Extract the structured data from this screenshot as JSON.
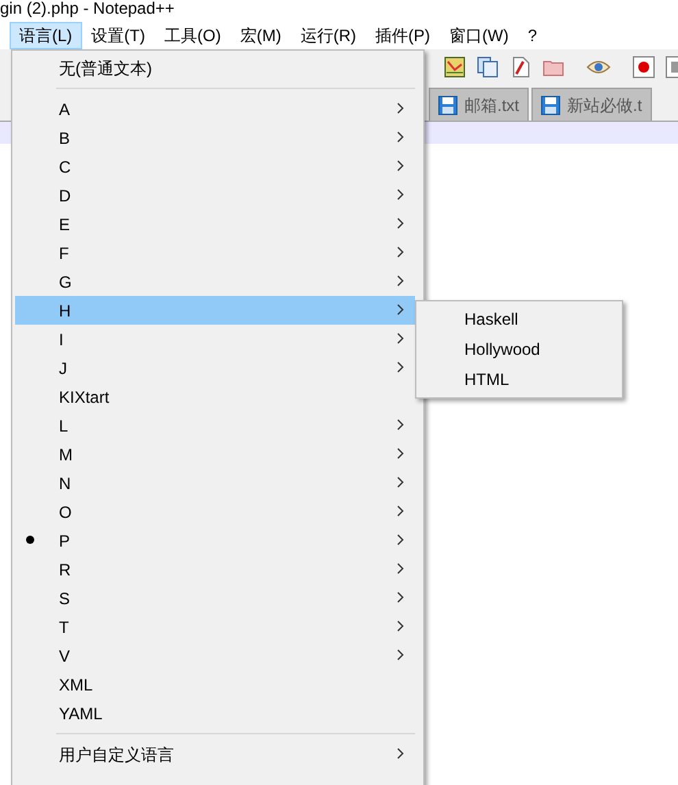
{
  "window": {
    "title": "gin (2).php - Notepad++"
  },
  "menu_bar": [
    {
      "label": "语言(L)",
      "selected": true
    },
    {
      "label": "设置(T)",
      "selected": false
    },
    {
      "label": "工具(O)",
      "selected": false
    },
    {
      "label": "宏(M)",
      "selected": false
    },
    {
      "label": "运行(R)",
      "selected": false
    },
    {
      "label": "插件(P)",
      "selected": false
    },
    {
      "label": "窗口(W)",
      "selected": false
    },
    {
      "label": "?",
      "selected": false
    }
  ],
  "tabs": [
    {
      "label": "邮箱.txt",
      "selected": false
    },
    {
      "label": "新站必做.t",
      "selected": false
    }
  ],
  "language_menu": [
    {
      "kind": "item",
      "label": "无(普通文本)",
      "submenu": false,
      "checked": false,
      "selected": false
    },
    {
      "kind": "separator"
    },
    {
      "kind": "item",
      "label": "A",
      "submenu": true,
      "checked": false,
      "selected": false
    },
    {
      "kind": "item",
      "label": "B",
      "submenu": true,
      "checked": false,
      "selected": false
    },
    {
      "kind": "item",
      "label": "C",
      "submenu": true,
      "checked": false,
      "selected": false
    },
    {
      "kind": "item",
      "label": "D",
      "submenu": true,
      "checked": false,
      "selected": false
    },
    {
      "kind": "item",
      "label": "E",
      "submenu": true,
      "checked": false,
      "selected": false
    },
    {
      "kind": "item",
      "label": "F",
      "submenu": true,
      "checked": false,
      "selected": false
    },
    {
      "kind": "item",
      "label": "G",
      "submenu": true,
      "checked": false,
      "selected": false
    },
    {
      "kind": "item",
      "label": "H",
      "submenu": true,
      "checked": false,
      "selected": true
    },
    {
      "kind": "item",
      "label": "I",
      "submenu": true,
      "checked": false,
      "selected": false
    },
    {
      "kind": "item",
      "label": "J",
      "submenu": true,
      "checked": false,
      "selected": false
    },
    {
      "kind": "item",
      "label": "KIXtart",
      "submenu": false,
      "checked": false,
      "selected": false
    },
    {
      "kind": "item",
      "label": "L",
      "submenu": true,
      "checked": false,
      "selected": false
    },
    {
      "kind": "item",
      "label": "M",
      "submenu": true,
      "checked": false,
      "selected": false
    },
    {
      "kind": "item",
      "label": "N",
      "submenu": true,
      "checked": false,
      "selected": false
    },
    {
      "kind": "item",
      "label": "O",
      "submenu": true,
      "checked": false,
      "selected": false
    },
    {
      "kind": "item",
      "label": "P",
      "submenu": true,
      "checked": true,
      "selected": false
    },
    {
      "kind": "item",
      "label": "R",
      "submenu": true,
      "checked": false,
      "selected": false
    },
    {
      "kind": "item",
      "label": "S",
      "submenu": true,
      "checked": false,
      "selected": false
    },
    {
      "kind": "item",
      "label": "T",
      "submenu": true,
      "checked": false,
      "selected": false
    },
    {
      "kind": "item",
      "label": "V",
      "submenu": true,
      "checked": false,
      "selected": false
    },
    {
      "kind": "item",
      "label": "XML",
      "submenu": false,
      "checked": false,
      "selected": false
    },
    {
      "kind": "item",
      "label": "YAML",
      "submenu": false,
      "checked": false,
      "selected": false
    },
    {
      "kind": "separator"
    },
    {
      "kind": "item",
      "label": "用户自定义语言",
      "submenu": true,
      "checked": false,
      "selected": false
    }
  ],
  "submenu": [
    {
      "label": "Haskell",
      "selected": false
    },
    {
      "label": "Hollywood",
      "selected": false
    },
    {
      "label": "HTML",
      "selected": false
    }
  ]
}
